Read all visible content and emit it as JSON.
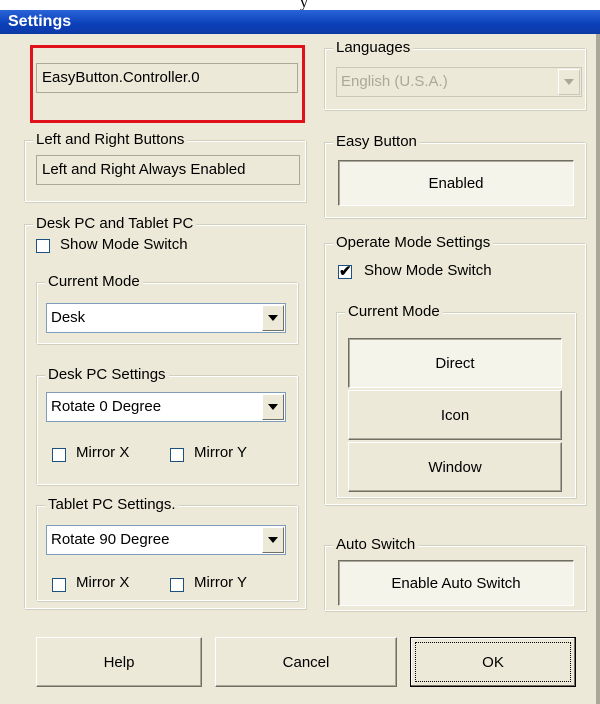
{
  "window": {
    "title": "Settings"
  },
  "page_peek_text": "y",
  "controller_name": "EasyButton.Controller.0",
  "languages": {
    "legend": "Languages",
    "selected": "English (U.S.A.)"
  },
  "left_right": {
    "legend": "Left and Right Buttons",
    "value": "Left and Right Always Enabled"
  },
  "easy_button": {
    "legend": "Easy Button",
    "button_label": "Enabled"
  },
  "desk_tablet": {
    "legend": "Desk PC and Tablet PC",
    "show_mode_switch_label": "Show Mode Switch",
    "show_mode_switch_checked": false,
    "current_mode": {
      "legend": "Current Mode",
      "selected": "Desk"
    },
    "desk_settings": {
      "legend": "Desk PC Settings",
      "selected": "Rotate 0 Degree",
      "mirror_x_label": "Mirror X",
      "mirror_y_label": "Mirror Y"
    },
    "tablet_settings": {
      "legend": "Tablet PC Settings.",
      "selected": "Rotate 90 Degree",
      "mirror_x_label": "Mirror X",
      "mirror_y_label": "Mirror Y"
    }
  },
  "operate_mode": {
    "legend": "Operate Mode Settings",
    "show_mode_switch_label": "Show Mode Switch",
    "show_mode_switch_checked": true,
    "check_glyph": "✔",
    "current_mode": {
      "legend": "Current Mode",
      "buttons": {
        "direct": "Direct",
        "icon": "Icon",
        "window": "Window"
      },
      "active": "Direct"
    }
  },
  "auto_switch": {
    "legend": "Auto Switch",
    "button_label": "Enable Auto Switch"
  },
  "footer": {
    "help": "Help",
    "cancel": "Cancel",
    "ok": "OK"
  },
  "colors": {
    "highlight": "#e0111b",
    "titlebar": "#0a3fb8",
    "face": "#ece9d8"
  }
}
